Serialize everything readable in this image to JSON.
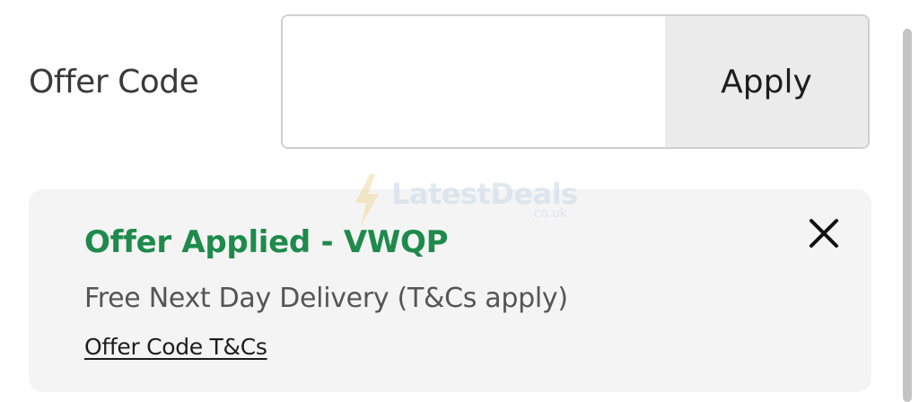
{
  "offer_code": {
    "label": "Offer Code",
    "input_value": "",
    "input_placeholder": "",
    "apply_label": "Apply"
  },
  "applied_offer": {
    "title": "Offer Applied - VWQP",
    "description": "Free Next Day Delivery (T&Cs apply)",
    "terms_link": "Offer Code T&Cs",
    "close_icon": "close-icon"
  },
  "watermark": {
    "brand": "LatestDeals",
    "domain": ".co.uk",
    "icon": "lightning-bolt-icon"
  },
  "colors": {
    "accent_green": "#1e8a4c",
    "card_background": "#f4f4f4",
    "apply_background": "#ebebeb"
  }
}
